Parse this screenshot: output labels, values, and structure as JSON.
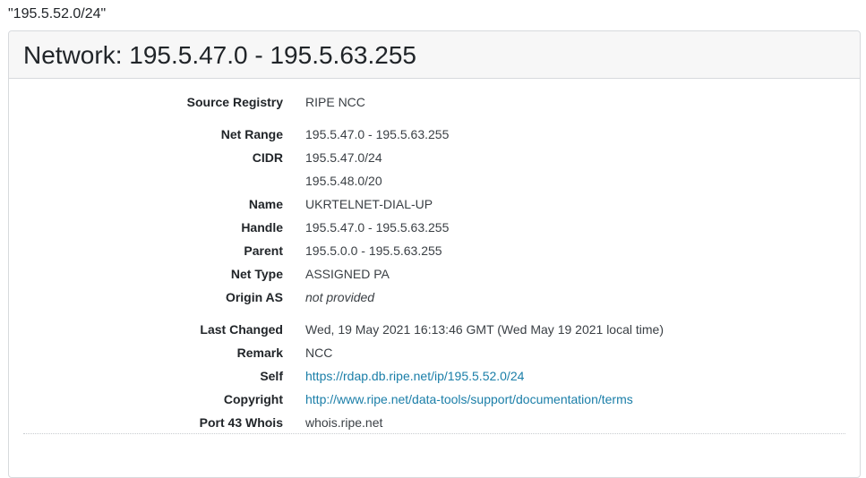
{
  "query": "\"195.5.52.0/24\"",
  "card": {
    "title": "Network: 195.5.47.0 - 195.5.63.255"
  },
  "fields": {
    "source_registry": {
      "label": "Source Registry",
      "value": "RIPE NCC"
    },
    "net_range": {
      "label": "Net Range",
      "value": "195.5.47.0 - 195.5.63.255"
    },
    "cidr": {
      "label": "CIDR",
      "values": [
        "195.5.47.0/24",
        "195.5.48.0/20"
      ]
    },
    "name": {
      "label": "Name",
      "value": "UKRTELNET-DIAL-UP"
    },
    "handle": {
      "label": "Handle",
      "value": "195.5.47.0 - 195.5.63.255"
    },
    "parent": {
      "label": "Parent",
      "value": "195.5.0.0 - 195.5.63.255"
    },
    "net_type": {
      "label": "Net Type",
      "value": "ASSIGNED PA"
    },
    "origin_as": {
      "label": "Origin AS",
      "value": "not provided"
    },
    "last_changed": {
      "label": "Last Changed",
      "value": "Wed, 19 May 2021 16:13:46 GMT (Wed May 19 2021 local time)"
    },
    "remark": {
      "label": "Remark",
      "value": "NCC"
    },
    "self": {
      "label": "Self",
      "value": "https://rdap.db.ripe.net/ip/195.5.52.0/24"
    },
    "copyright": {
      "label": "Copyright",
      "value": "http://www.ripe.net/data-tools/support/documentation/terms"
    },
    "port43": {
      "label": "Port 43 Whois",
      "value": "whois.ripe.net"
    }
  },
  "colors": {
    "link": "#1a7ea8",
    "header_bg": "#f7f7f7",
    "border": "#d7dadd"
  }
}
